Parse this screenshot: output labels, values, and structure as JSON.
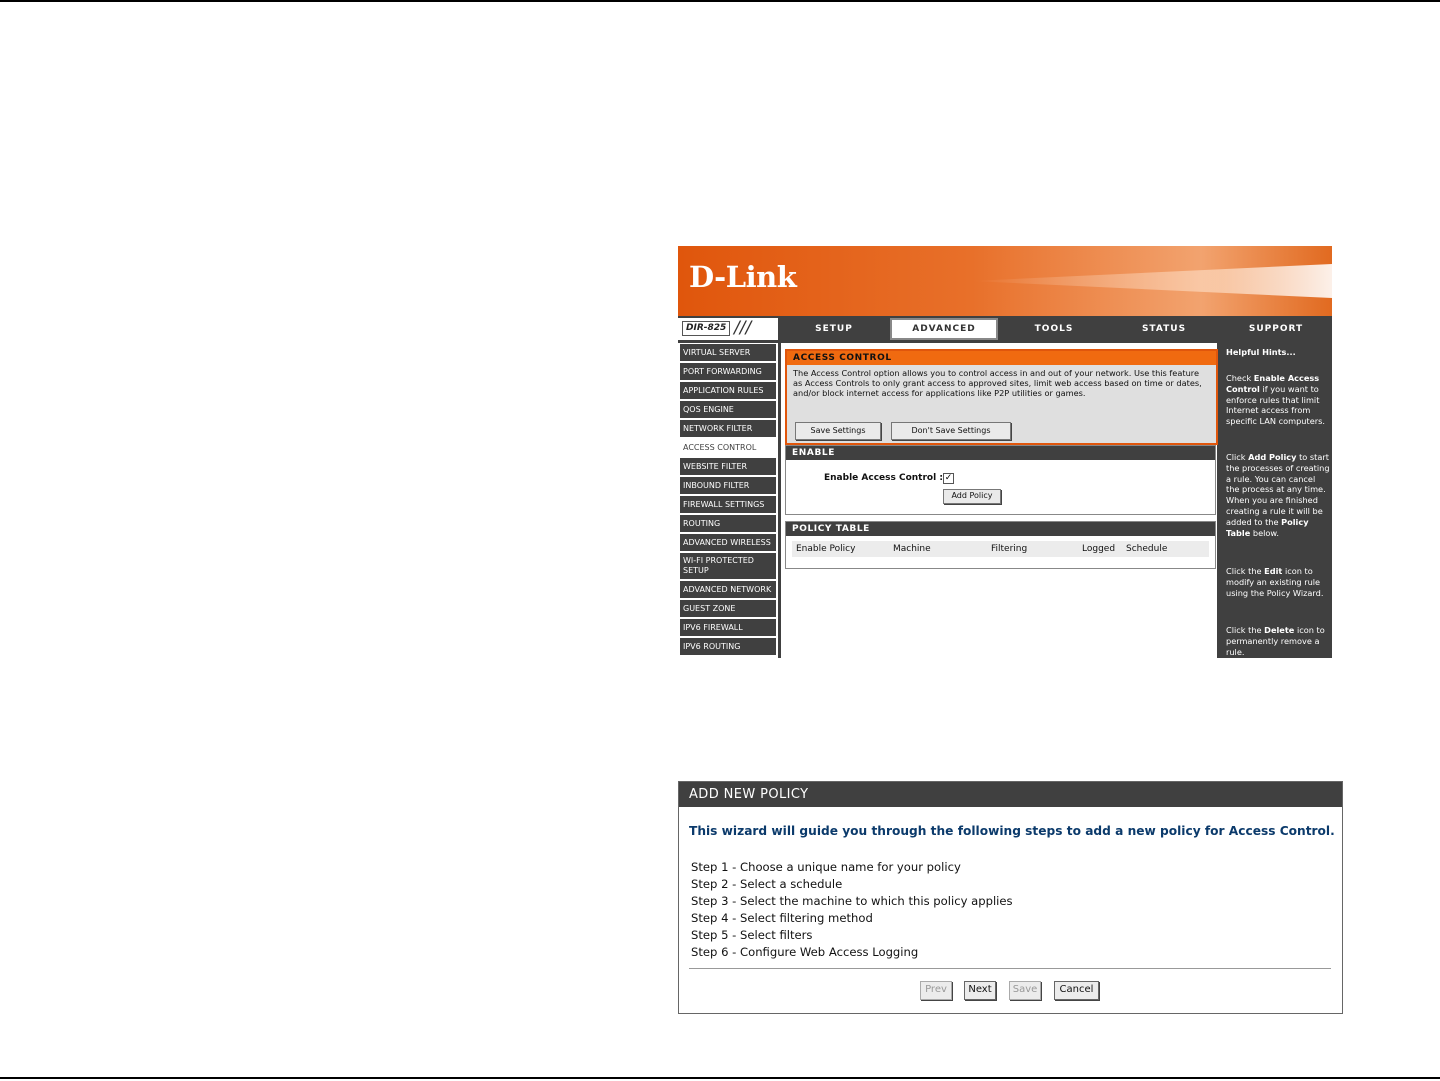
{
  "router": {
    "logo": "D-Link",
    "model": "DIR-825",
    "slashes": "///",
    "nav_tabs": [
      "SETUP",
      "ADVANCED",
      "TOOLS",
      "STATUS",
      "SUPPORT"
    ],
    "active_tab": "ADVANCED",
    "sidebar": [
      "VIRTUAL SERVER",
      "PORT FORWARDING",
      "APPLICATION RULES",
      "QOS ENGINE",
      "NETWORK FILTER",
      "ACCESS CONTROL",
      "WEBSITE FILTER",
      "INBOUND FILTER",
      "FIREWALL SETTINGS",
      "ROUTING",
      "ADVANCED WIRELESS",
      "WI-FI PROTECTED SETUP",
      "ADVANCED NETWORK",
      "GUEST ZONE",
      "IPV6 FIREWALL",
      "IPV6 ROUTING"
    ],
    "active_sidebar": "ACCESS CONTROL",
    "access_control": {
      "title": "ACCESS CONTROL",
      "description": "The Access Control option allows you to control access in and out of your network. Use this feature as Access Controls to only grant access to approved sites, limit web access based on time or dates, and/or block internet access for applications like P2P utilities or games.",
      "save_button": "Save Settings",
      "dont_save_button": "Don't Save Settings"
    },
    "enable": {
      "title": "ENABLE",
      "label": "Enable Access Control :",
      "checked": true,
      "add_policy_button": "Add Policy"
    },
    "policy_table": {
      "title": "POLICY TABLE",
      "columns": [
        "Enable Policy",
        "Machine",
        "Filtering",
        "Logged",
        "Schedule"
      ]
    },
    "hints": {
      "title": "Helpful Hints...",
      "hint1": {
        "pre": "Check ",
        "bold": "Enable Access Control",
        "post": " if you want to enforce rules that limit Internet access from specific LAN computers."
      },
      "hint2": {
        "pre": "Click ",
        "bold": "Add Policy",
        "mid": " to start the processes of creating a rule. You can cancel the process at any time. When you are finished creating a rule it will be added to the ",
        "bold2": "Policy Table",
        "post": " below."
      },
      "hint3": {
        "pre": "Click the ",
        "bold": "Edit",
        "post": " icon to modify an existing rule using the Policy Wizard."
      },
      "hint4": {
        "pre": "Click the ",
        "bold": "Delete",
        "post": " icon to permanently remove a rule."
      }
    }
  },
  "add_policy": {
    "title": "ADD NEW POLICY",
    "intro": "This wizard will guide you through the following steps to add a new policy for Access Control.",
    "steps": [
      "Step 1 - Choose a unique name for your policy",
      "Step 2 - Select a schedule",
      "Step 3 - Select the machine to which this policy applies",
      "Step 4 - Select filtering method",
      "Step 5 - Select filters",
      "Step 6 - Configure Web Access Logging"
    ],
    "buttons": {
      "prev": "Prev",
      "next": "Next",
      "save": "Save",
      "cancel": "Cancel"
    }
  }
}
